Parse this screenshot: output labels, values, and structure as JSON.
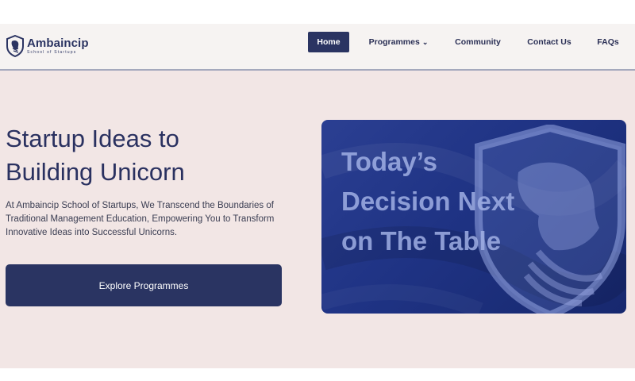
{
  "brand": {
    "name": "Ambaincip",
    "tagline": "School of Startups"
  },
  "nav": {
    "home": "Home",
    "programmes": "Programmes",
    "community": "Community",
    "contact": "Contact Us",
    "faqs": "FAQs"
  },
  "hero": {
    "title": "Startup Ideas to Building Unicorn",
    "description": "At Ambaincip School of Startups, We Transcend the Boundaries of Traditional Management Education, Empowering You to Transform Innovative Ideas into Successful Unicorns.",
    "cta_label": "Explore Programmes",
    "banner_text": "Today’s Decision Next on The Table"
  },
  "icons": {
    "logo": "lion-shield-icon",
    "dropdown": "chevron-down-icon",
    "banner_watermark": "lion-shield-icon"
  },
  "colors": {
    "brand": "#2a3462",
    "nav_background": "#f6f3f2",
    "hero_background": "#f2e6e5",
    "banner_background": "#1f3384"
  }
}
